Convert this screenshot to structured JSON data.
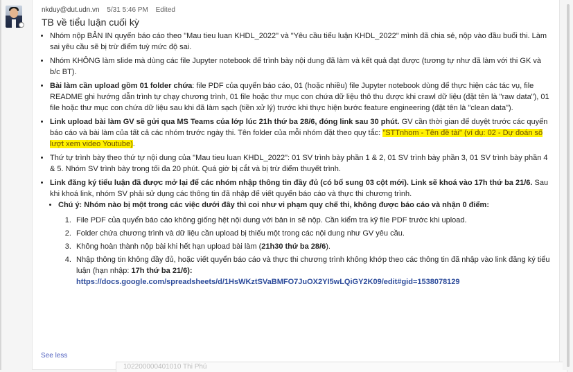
{
  "message": {
    "author": "nkduy@dut.udn.vn",
    "time": "5/31 5:46 PM",
    "edited": "Edited",
    "title": "TB về tiểu luận cuối kỳ",
    "b1": "Nhóm nộp BẢN IN quyển báo cáo theo \"Mau tieu luan KHDL_2022\" và \"Yêu cầu tiểu luận KHDL_2022\" mình đã chia sẻ, nộp vào đầu buổi thi. Làm sai yêu cầu sẽ bị trừ điểm tuỳ mức độ sai.",
    "b2": "Nhóm KHÔNG làm slide mà dùng các file Jupyter notebook để trình bày nội dung đã làm và kết quả đạt được (tương tự như đã làm với thi GK và b/c BT).",
    "b3_bold": "Bài làm cần upload gồm 01 folder chứa",
    "b3_rest": ": file PDF của quyển báo cáo, 01 (hoặc nhiều) file Jupyter notebook dùng để thực hiện các tác vụ, file README ghi hướng dẫn trình tự chạy chương trình, 01 file hoặc thư mục con chứa dữ liệu thô thu được khi crawl dữ liệu (đặt tên là \"raw data\"), 01 file hoặc thư mục con chứa dữ liệu sau khi đã làm sạch (tiền xử lý) trước khi thực hiện bước feature engineering (đặt tên là \"clean data\").",
    "b4_bold": "Link upload bài làm GV sẽ gửi qua MS Teams của lớp lúc 21h thứ ba 28/6, đóng link sau 30 phút.",
    "b4_rest": " GV cần thời gian để duyệt trước các quyển báo cáo và bài làm của tất cả các nhóm trước ngày thi. Tên folder của mỗi nhóm đặt theo quy tắc: ",
    "b4_highlight": "\"STTnhom - Tên đề tài\" (ví dụ: 02 - Dự đoán số lượt xem video Youtube)",
    "b4_end": ".",
    "b5": "Thứ tự trình bày theo thứ tự nội dung của \"Mau tieu luan KHDL_2022\": 01 SV trình bày phần 1 & 2, 01 SV trình bày phần 3, 01 SV trình bày phần 4 & 5. Nhóm SV trình bày trong tối đa 20 phút. Quá giờ bị cắt và bị trừ điểm thuyết trình.",
    "b6_bold": "Link đăng ký tiểu luận đã được mở lại để các nhóm nhập thông tin đầy đủ (có bổ sung 03 cột mới). Link sẽ khoá vào 17h thứ ba 21/6.",
    "b6_rest": " Sau khi khoá link, nhóm SV phải sử dụng các thông tin đã nhập để viết quyển báo cáo và thực thi chương trình.",
    "note": "Chú ý: Nhóm nào bị một trong các việc dưới đây thì coi như vi phạm quy chế thi, không được báo cáo và nhận 0 điểm:",
    "n1": "File PDF của quyển báo cáo không giống hệt nội dung với bản in sẽ nộp. Cần kiểm tra kỹ file PDF trước khi upload.",
    "n2": "Folder chứa chương trình và dữ liệu cần upload bị thiếu một trong các nội dung như GV yêu cầu.",
    "n3_pre": "Không hoàn thành nộp bài khi hết hạn upload bài làm (",
    "n3_bold": "21h30 thứ ba 28/6",
    "n3_post": ").",
    "n4_pre": "Nhập thông tin không đầy đủ, hoặc viết quyển báo cáo và thực thi chương trình không khớp theo các thông tin đã nhập vào link đăng ký tiểu luận (hạn nhập: ",
    "n4_bold": "17h thứ ba 21/6):",
    "link": "https://docs.google.com/spreadsheets/d/1HsWKztSVaBMFO7JuOX2YI5wLQiGY2K09/edit#gid=1538078129",
    "see_less": "See less",
    "reply_preview": "102200000401010 Thi Phú"
  },
  "colors": {
    "highlight": "#fff100",
    "link": "#2b4a9a",
    "see_less": "#4e5fbf"
  }
}
